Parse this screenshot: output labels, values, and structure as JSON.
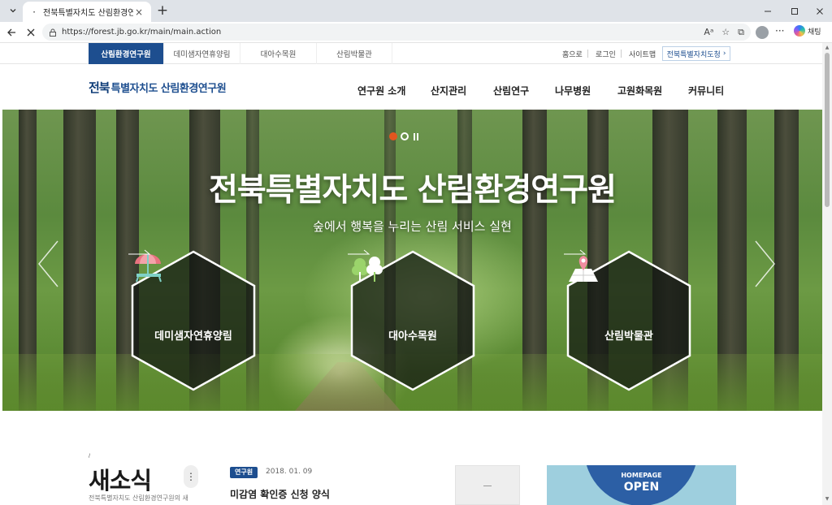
{
  "browser": {
    "tab_title": "전북특별자치도 산림환경연구원",
    "tab_favicon": "loading-dot-icon",
    "new_tab_symbol": "+",
    "url": "https://forest.jb.go.kr/main/main.action",
    "copilot_label": "채팅"
  },
  "site_tabs": {
    "items": [
      "산림환경연구원",
      "데미샘자연휴양림",
      "대아수목원",
      "산림박물관"
    ],
    "active_index": 0
  },
  "util_links": {
    "home": "홈으로",
    "login": "로그인",
    "sitemap": "사이트맵",
    "province": "전북특별자치도청"
  },
  "header": {
    "logo_mark": "전북",
    "logo_text": "특별자치도 산림환경연구원",
    "nav": [
      "연구원 소개",
      "산지관리",
      "산림연구",
      "나무병원",
      "고원화목원",
      "커뮤니티"
    ]
  },
  "hero": {
    "title": "전북특별자치도 산림환경연구원",
    "subtitle": "숲에서 행복을 누리는 산림 서비스 실현",
    "slide_count": 2,
    "active_slide": 1,
    "cards": [
      {
        "label": "데미샘자연휴양림",
        "icon": "parasol-bench-icon"
      },
      {
        "label": "대아수목원",
        "icon": "trees-icon"
      },
      {
        "label": "산림박물관",
        "icon": "map-pin-icon"
      }
    ]
  },
  "news": {
    "deco": "/",
    "title": "새소식",
    "description": "전북특별자치도 산림환경연구원의 새",
    "badge": "연구원",
    "date": "2018. 01. 09",
    "headline": "미감염 확인증 신청 양식",
    "banner_line1": "HOMEPAGE",
    "banner_line2": "OPEN"
  },
  "colors": {
    "brand_blue": "#1d4e8f",
    "active_dot": "#e3561f",
    "banner_bg": "#9ecfde"
  }
}
